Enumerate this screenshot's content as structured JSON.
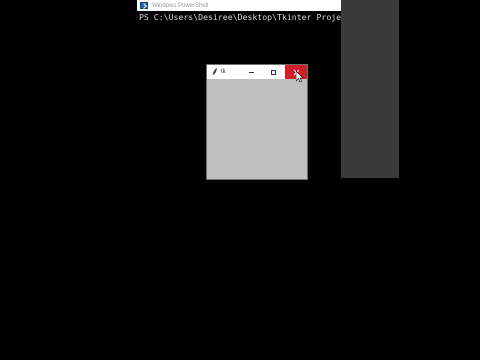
{
  "powershell": {
    "title": "Windows PowerShell",
    "prompt_line": "PS C:\\Users\\Desiree\\Desktop\\Tkinter Proje"
  },
  "tk_window": {
    "title": "tk",
    "buttons": {
      "minimize": "minimize",
      "maximize": "maximize",
      "close": "close"
    }
  },
  "colors": {
    "background": "#000000",
    "close_button": "#d21d2a",
    "tk_body": "#bfbfbf",
    "side_window": "#3a3a3a"
  }
}
